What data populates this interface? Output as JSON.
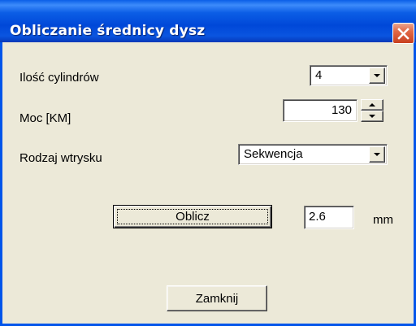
{
  "window": {
    "title": "Obliczanie średnicy dysz"
  },
  "icons": {
    "close": "close-icon",
    "dropdown": "chevron-down-icon",
    "spin_up": "spin-up-icon",
    "spin_down": "spin-down-icon"
  },
  "colors": {
    "titlebar": "#0055ea",
    "close_button": "#e16745",
    "dialog_background": "#ece9d8"
  },
  "form": {
    "cylinders": {
      "label": "Ilość cylindrów",
      "value": "4"
    },
    "power": {
      "label": "Moc [KM]",
      "value": "130"
    },
    "injection": {
      "label": "Rodzaj wtrysku",
      "value": "Sekwencja"
    },
    "result": {
      "value": "2.6",
      "unit": "mm"
    }
  },
  "buttons": {
    "calculate": "Oblicz",
    "close": "Zamknij"
  }
}
